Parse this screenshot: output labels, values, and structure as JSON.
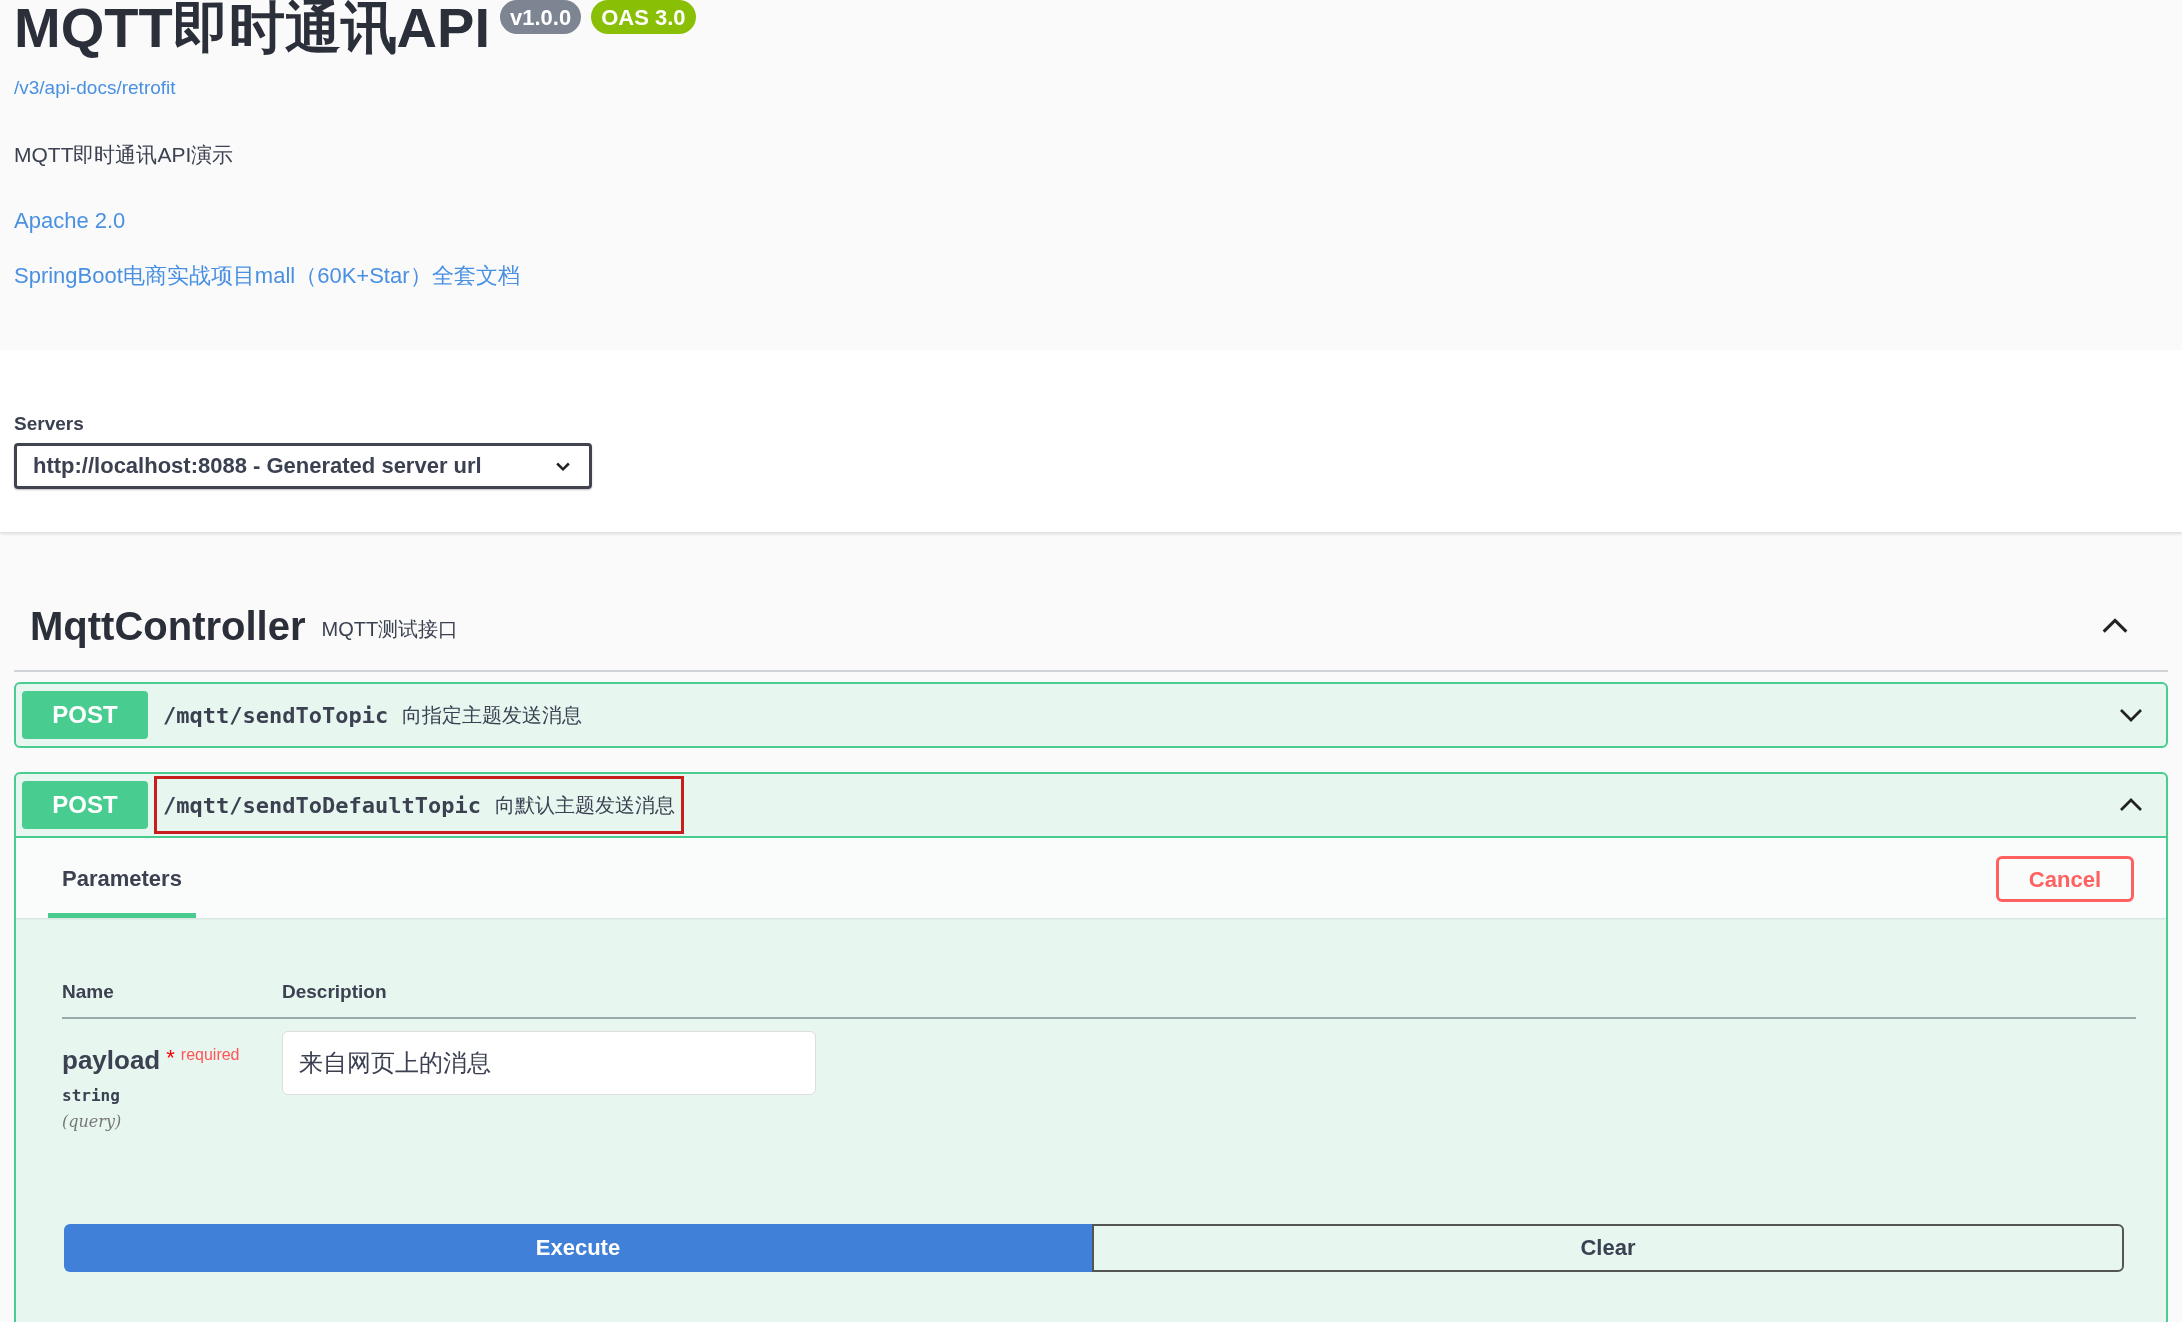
{
  "info": {
    "title": "MQTT即时通讯API",
    "version": "v1.0.0",
    "oas": "OAS 3.0",
    "url": "/v3/api-docs/retrofit",
    "description": "MQTT即时通讯API演示",
    "links": [
      "Apache 2.0",
      "SpringBoot电商实战项目mall（60K+Star）全套文档"
    ]
  },
  "servers": {
    "label": "Servers",
    "selected": "http://localhost:8088 - Generated server url"
  },
  "tag": {
    "name": "MqttController",
    "description": "MQTT测试接口",
    "expanded": true
  },
  "operations": [
    {
      "method": "POST",
      "path": "/mqtt/sendToTopic",
      "summary": "向指定主题发送消息",
      "expanded": false,
      "highlighted": false
    },
    {
      "method": "POST",
      "path": "/mqtt/sendToDefaultTopic",
      "summary": "向默认主题发送消息",
      "expanded": true,
      "highlighted": true,
      "tabs": [
        {
          "label": "Parameters",
          "selected": true
        }
      ],
      "cancel": "Cancel",
      "columns": [
        "Name",
        "Description"
      ],
      "parameters": [
        {
          "name": "payload",
          "required": true,
          "required_mark": "*",
          "required_label": "required",
          "type": "string",
          "location": "(query)",
          "value": "来自网页上的消息"
        }
      ],
      "execute": "Execute",
      "clear": "Clear"
    }
  ]
}
